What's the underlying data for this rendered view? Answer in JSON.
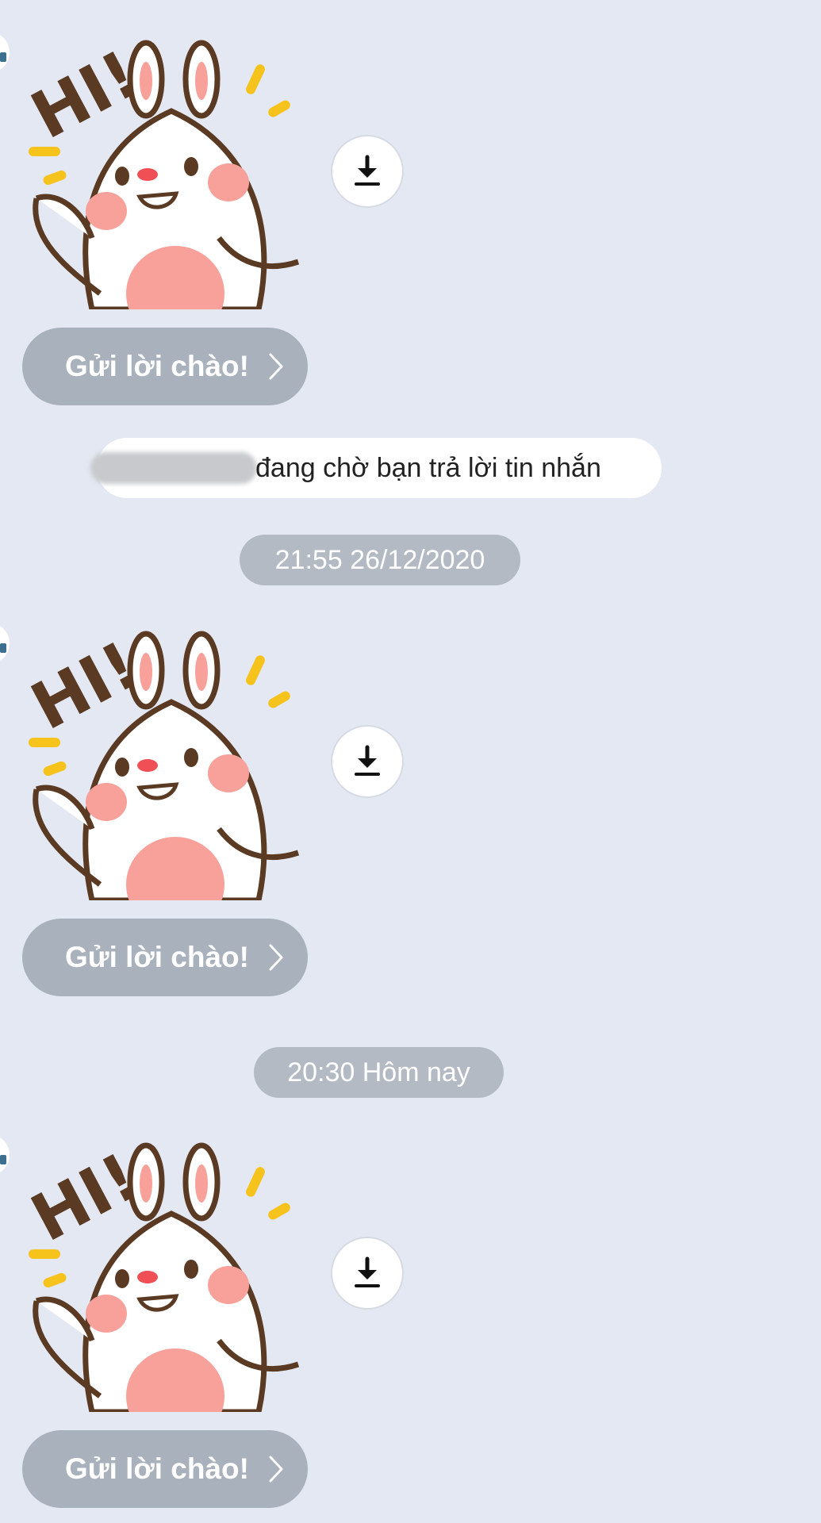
{
  "chat": {
    "greeting_blocks": [
      {
        "button_label": "Gửi lời chào!"
      },
      {
        "button_label": "Gửi lời chào!"
      },
      {
        "button_label": "Gửi lời chào!"
      }
    ],
    "notice": {
      "name": "",
      "text": "đang chờ bạn trả lời tin nhắn"
    },
    "timestamps": [
      "21:55 26/12/2020",
      "20:30 Hôm nay"
    ],
    "sticker_text": "HI!"
  },
  "colors": {
    "background": "#e3e8f2",
    "button": "#a9b1bc",
    "timestamp_pill": "#b4bac3",
    "sticker_outline": "#5a3a22",
    "sticker_pink": "#f8a09a",
    "sticker_yellow": "#f6c21c"
  }
}
